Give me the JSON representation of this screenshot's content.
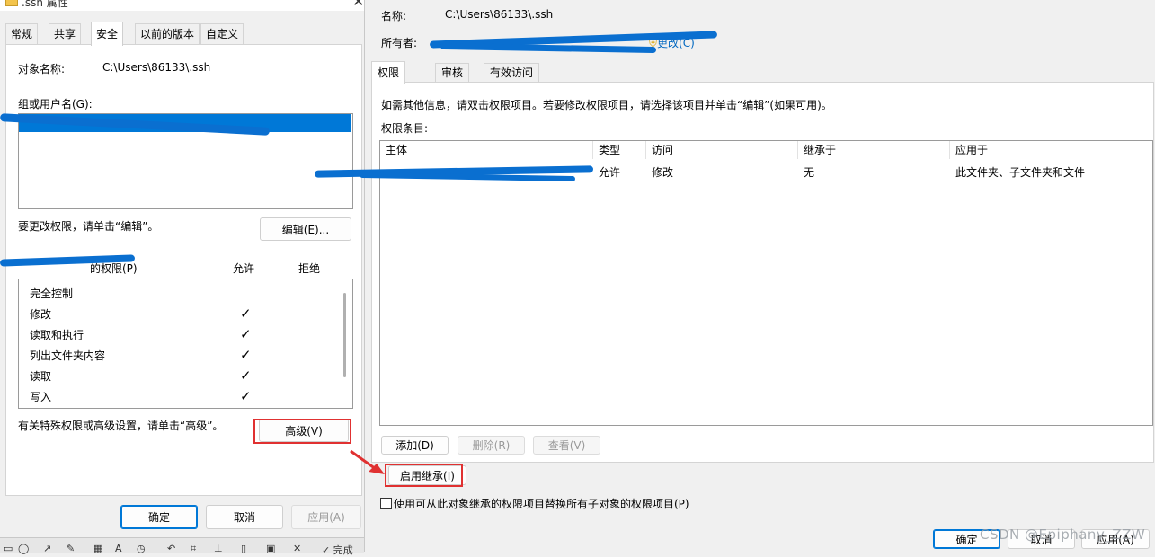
{
  "left_dialog": {
    "title": ".ssh 属性",
    "tabs": [
      "常规",
      "共享",
      "安全",
      "以前的版本",
      "自定义"
    ],
    "active_tab": "安全",
    "object_name_label": "对象名称:",
    "object_name_value": "C:\\Users\\86133\\.ssh",
    "groups_label": "组或用户名(G):",
    "change_perm_text": "要更改权限，请单击“编辑”。",
    "edit_button": "编辑(E)...",
    "perm_for_label": "的权限(P)",
    "allow_header": "允许",
    "deny_header": "拒绝",
    "permissions": [
      {
        "name": "完全控制",
        "allow": false
      },
      {
        "name": "修改",
        "allow": true
      },
      {
        "name": "读取和执行",
        "allow": true
      },
      {
        "name": "列出文件夹内容",
        "allow": true
      },
      {
        "name": "读取",
        "allow": true
      },
      {
        "name": "写入",
        "allow": true
      }
    ],
    "advanced_text": "有关特殊权限或高级设置，请单击“高级”。",
    "advanced_button": "高级(V)",
    "ok_button": "确定",
    "cancel_button": "取消",
    "apply_button": "应用(A)",
    "taskbar_done": "完成"
  },
  "right_dialog": {
    "name_label": "名称:",
    "name_value": "C:\\Users\\86133\\.ssh",
    "owner_label": "所有者:",
    "change_owner_link": "更改(C)",
    "tabs": [
      "权限",
      "审核",
      "有效访问"
    ],
    "active_tab": "权限",
    "info_text": "如需其他信息，请双击权限项目。若要修改权限项目，请选择该项目并单击“编辑”(如果可用)。",
    "entries_label": "权限条目:",
    "table_headers": [
      "主体",
      "类型",
      "访问",
      "继承于",
      "应用于"
    ],
    "table_rows": [
      {
        "principal": "",
        "type": "允许",
        "access": "修改",
        "inherited_from": "无",
        "applies_to": "此文件夹、子文件夹和文件"
      }
    ],
    "add_button": "添加(D)",
    "remove_button": "删除(R)",
    "view_button": "查看(V)",
    "enable_inheritance_button": "启用继承(I)",
    "replace_checkbox_label": "使用可从此对象继承的权限项目替换所有子对象的权限项目(P)",
    "ok_button": "确定",
    "cancel_button": "取消",
    "apply_button": "应用(A)"
  },
  "watermark": "CSDN @Epiphany_ZZW",
  "colors": {
    "accent": "#0078d7",
    "highlight_red": "#e03131",
    "redaction_blue": "#0a6fd0"
  }
}
